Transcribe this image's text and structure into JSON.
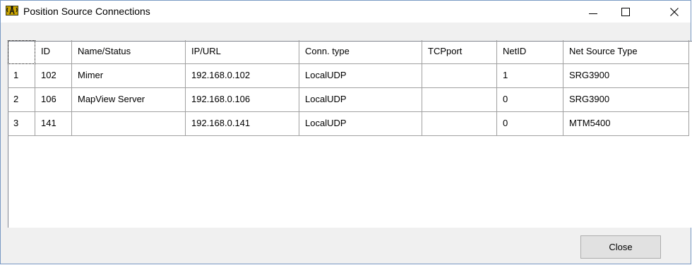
{
  "window": {
    "title": "Position Source Connections",
    "icon": "radio-tower-app-icon",
    "controls": {
      "minimize": "minimize-icon",
      "maximize": "maximize-icon",
      "close": "close-icon"
    }
  },
  "table": {
    "columns": [
      "",
      "ID",
      "Name/Status",
      "IP/URL",
      "Conn. type",
      "TCPport",
      "NetID",
      "Net Source Type"
    ],
    "rows": [
      [
        "1",
        "102",
        "Mimer",
        "192.168.0.102",
        "LocalUDP",
        "",
        "1",
        "SRG3900"
      ],
      [
        "2",
        "106",
        "MapView Server",
        "192.168.0.106",
        "LocalUDP",
        "",
        "0",
        "SRG3900"
      ],
      [
        "3",
        "141",
        "",
        "192.168.0.141",
        "LocalUDP",
        "",
        "0",
        "MTM5400"
      ]
    ]
  },
  "footer": {
    "close_label": "Close"
  },
  "colors": {
    "window_border": "#7a9ac4",
    "grid_line": "#a0a0a0",
    "button_face": "#e1e1e1"
  }
}
